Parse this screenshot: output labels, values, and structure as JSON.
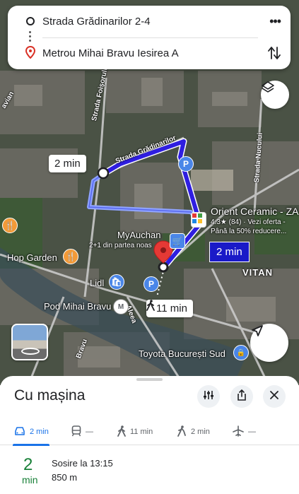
{
  "directions": {
    "origin": "Strada Grădinarilor 2-4",
    "destination": "Metrou Mihai Bravu Iesirea A",
    "more_icon": "more-horiz-icon",
    "swap_icon": "swap-vertical-icon"
  },
  "map": {
    "streets": [
      "Strada Foișorului",
      "Strada Grădinarilor",
      "Strada Nucului",
      "Aleea",
      "Bravu",
      "avian"
    ],
    "places": {
      "orient": "Orient Ceramic - ZA",
      "orient_rating": "4.3★ (84) · Vezi oferta -",
      "orient_promo": "Până la 50% reducere...",
      "myauchan": "MyAuchan",
      "myauchan_sub": "2+1 din partea noas",
      "hop_garden": "Hop Garden",
      "lidl": "Lidl",
      "pod": "Pod Mihai Bravu",
      "vitan": "VITAN",
      "toyota": "Toyota București Sud"
    },
    "drive_bubble": "2 min",
    "alt_bubble": "2 min",
    "walk_bubble": "11 min",
    "route_color": "#2f1ee0",
    "alt_route_color": "#8ea2ff"
  },
  "sheet": {
    "title": "Cu mașina",
    "modes": [
      {
        "icon": "car-icon",
        "label": "2 min"
      },
      {
        "icon": "transit-icon",
        "label": "—"
      },
      {
        "icon": "walk-icon",
        "label": "11 min"
      },
      {
        "icon": "cycle-icon",
        "label": "2 min"
      },
      {
        "icon": "flight-icon",
        "label": "—"
      }
    ],
    "route": {
      "time": "2",
      "unit": "min",
      "arrival": "Sosire la 13:15",
      "distance": "850 m"
    }
  },
  "colors": {
    "accent": "#1a73e8",
    "eta_green": "#188038"
  }
}
